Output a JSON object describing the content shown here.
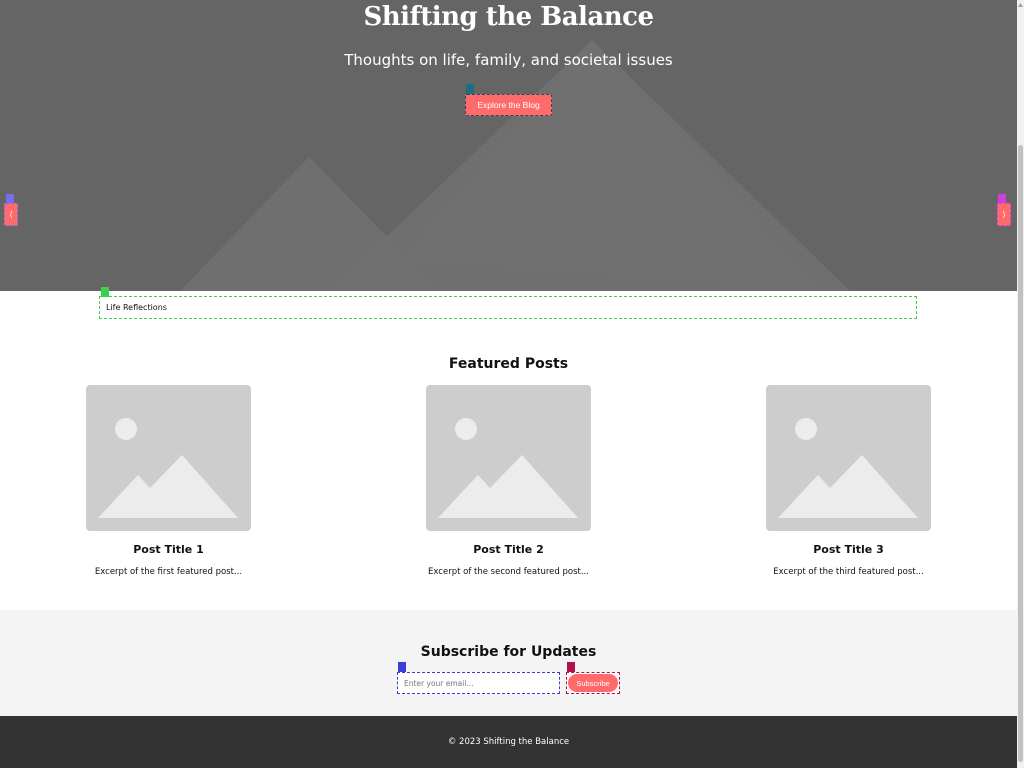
{
  "hero": {
    "title": "Shifting the Balance",
    "subtitle": "Thoughts on life, family, and societal issues",
    "cta_label": "Explore the Blog",
    "prev_label": "⟨",
    "next_label": "⟩"
  },
  "category_bar": {
    "label": "Life Reflections"
  },
  "featured": {
    "heading": "Featured Posts",
    "posts": [
      {
        "title": "Post Title 1",
        "excerpt": "Excerpt of the first featured post..."
      },
      {
        "title": "Post Title 2",
        "excerpt": "Excerpt of the second featured post..."
      },
      {
        "title": "Post Title 3",
        "excerpt": "Excerpt of the third featured post..."
      }
    ]
  },
  "subscribe": {
    "heading": "Subscribe for Updates",
    "email_placeholder": "Enter your email...",
    "button_label": "Subscribe"
  },
  "footer": {
    "copyright": "© 2023 Shifting the Balance"
  },
  "colors": {
    "accent": "#ff6b6b",
    "hero_bg": "#656565",
    "footer_bg": "#333333",
    "subscribe_bg": "#f4f4f4"
  },
  "icons": {
    "post_thumbnail": "image-placeholder-icon"
  }
}
